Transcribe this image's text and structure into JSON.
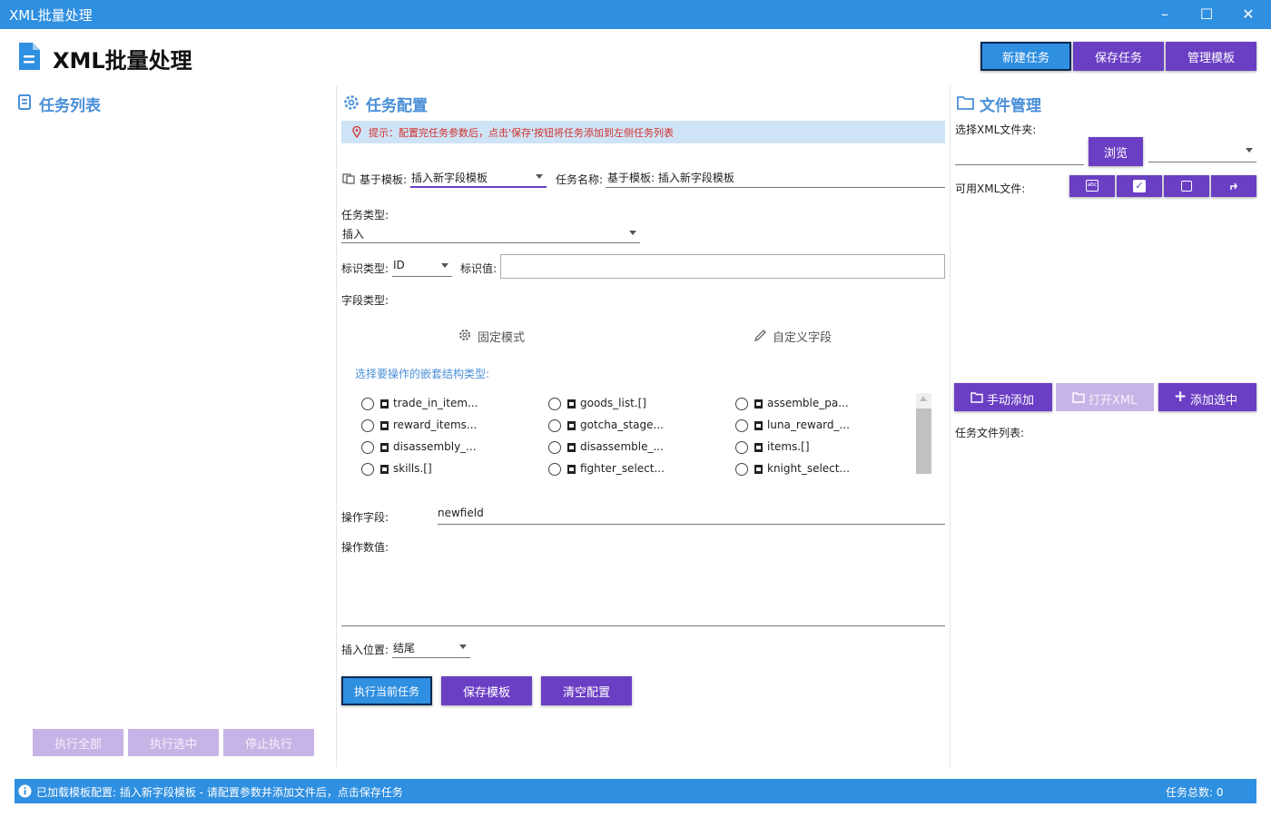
{
  "window": {
    "title": "XML批量处理",
    "min_icon": "minimize-icon",
    "max_icon": "maximize-icon",
    "close_icon": "close-icon"
  },
  "header": {
    "title": "XML批量处理",
    "buttons": {
      "new_task": "新建任务",
      "save_task": "保存任务",
      "manage_templates": "管理模板"
    }
  },
  "left": {
    "title": "任务列表",
    "buttons": {
      "run_all": "执行全部",
      "run_selected": "执行选中",
      "stop": "停止执行"
    }
  },
  "config": {
    "title": "任务配置",
    "hint": "提示：配置完任务参数后，点击'保存'按钮将任务添加到左侧任务列表",
    "template_label": "基于模板:",
    "template_value": "插入新字段模板",
    "task_name_label": "任务名称:",
    "task_name_value": "基于模板: 插入新字段模板",
    "task_type_label": "任务类型:",
    "task_type_value": "插入",
    "id_type_label": "标识类型:",
    "id_type_value": "ID",
    "id_value_label": "标识值:",
    "id_value": "",
    "field_type_label": "字段类型:",
    "fixed_mode": "固定模式",
    "custom_field": "自定义字段",
    "nested_label": "选择要操作的嵌套结构类型:",
    "nested_items": [
      "trade_in_item...",
      "goods_list.[]",
      "assemble_pa...",
      "reward_items...",
      "gotcha_stage...",
      "luna_reward_...",
      "disassembly_...",
      "disassemble_...",
      "items.[]",
      "skills.[]",
      "fighter_select...",
      "knight_select..."
    ],
    "op_field_label": "操作字段:",
    "op_field_value": "newfield",
    "op_value_label": "操作数值:",
    "op_value": "",
    "insert_pos_label": "插入位置:",
    "insert_pos_value": "结尾",
    "buttons": {
      "run_current": "执行当前任务",
      "save_template": "保存模板",
      "clear": "清空配置"
    }
  },
  "files": {
    "title": "文件管理",
    "folder_label": "选择XML文件夹:",
    "folder_value": "",
    "browse": "浏览",
    "available_label": "可用XML文件:",
    "icon_buttons": [
      "text-format-icon",
      "check-all-icon",
      "uncheck-icon",
      "return-icon"
    ],
    "manual_add": "手动添加",
    "open_xml": "打开XML",
    "add_selected": "添加选中",
    "task_files_label": "任务文件列表:"
  },
  "status": {
    "message": "已加载模板配置: 插入新字段模板 - 请配置参数并添加文件后，点击保存任务",
    "count": "任务总数: 0"
  },
  "colors": {
    "accent_blue": "#2f8fe0",
    "purple": "#6b3fc4",
    "disabled_purple": "#c7b4e6",
    "hint_red": "#d0312d",
    "title_blue": "#4a8fd8"
  }
}
